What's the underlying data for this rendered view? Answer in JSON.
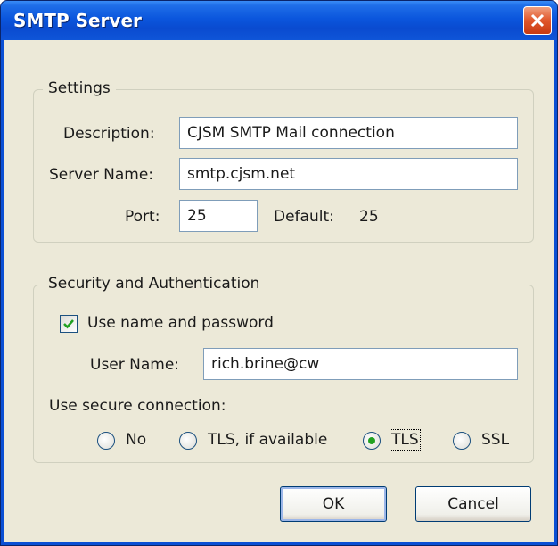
{
  "window": {
    "title": "SMTP Server"
  },
  "settings": {
    "legend": "Settings",
    "description_label": "Description:",
    "description_value": "CJSM SMTP  Mail connection",
    "server_name_label": "Server Name:",
    "server_name_value": "smtp.cjsm.net",
    "port_label": "Port:",
    "port_value": "25",
    "default_label": "Default:",
    "default_value": "25"
  },
  "security": {
    "legend": "Security and Authentication",
    "use_name_password_label": "Use name and password",
    "use_name_password_checked": true,
    "user_name_label": "User Name:",
    "user_name_value": "rich.brine@cw",
    "secure_connection_label": "Use secure connection:",
    "options": [
      {
        "label": "No",
        "selected": false
      },
      {
        "label": "TLS, if available",
        "selected": false
      },
      {
        "label": "TLS",
        "selected": true
      },
      {
        "label": "SSL",
        "selected": false
      }
    ]
  },
  "buttons": {
    "ok": "OK",
    "cancel": "Cancel"
  },
  "colors": {
    "titlebar": "#0a4bd0",
    "dialog_bg": "#ece9d8",
    "radio_selected": "#21a121",
    "checkbox_check": "#21a121"
  }
}
